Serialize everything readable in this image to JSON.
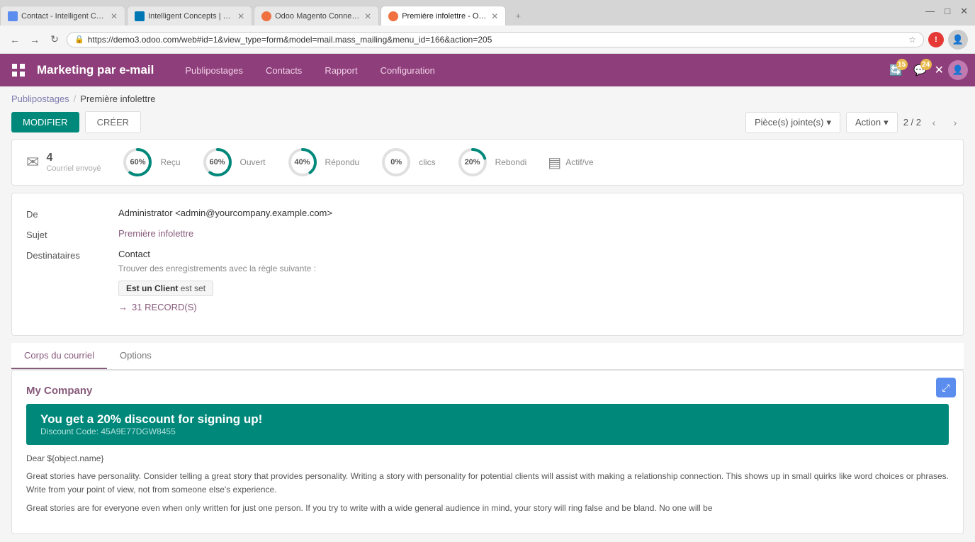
{
  "browser": {
    "tabs": [
      {
        "id": "tab1",
        "favicon_color": "#5b8def",
        "label": "Contact - Intelligent Con...",
        "active": false
      },
      {
        "id": "tab2",
        "favicon_color": "#0077b5",
        "label": "Intelligent Concepts | Lin...",
        "active": false
      },
      {
        "id": "tab3",
        "favicon_color": "#f07040",
        "label": "Odoo Magento Connect...",
        "active": false
      },
      {
        "id": "tab4",
        "favicon_color": "#f07040",
        "label": "Première infolettre - Odo...",
        "active": true
      }
    ],
    "url": "https://demo3.odoo.com/web#id=1&view_type=form&model=mail.mass_mailing&menu_id=166&action=205",
    "window_btns": [
      "—",
      "□",
      "✕"
    ]
  },
  "app": {
    "title": "Marketing par e-mail",
    "nav": [
      "Publipostages",
      "Contacts",
      "Rapport",
      "Configuration"
    ],
    "header_badges": [
      {
        "icon": "🔄",
        "count": "15"
      },
      {
        "icon": "💬",
        "count": "24"
      }
    ]
  },
  "breadcrumb": {
    "parent": "Publipostages",
    "separator": "/",
    "current": "Première infolettre"
  },
  "toolbar": {
    "modifier_label": "MODIFIER",
    "creer_label": "CRÉER",
    "pieces_jointes_label": "Pièce(s) jointe(s)",
    "action_label": "Action",
    "pagination_current": "2",
    "pagination_total": "2"
  },
  "stats": [
    {
      "type": "mail",
      "count": "4",
      "label": "Courriel envoyé"
    },
    {
      "type": "circle",
      "percent": 60,
      "label": "Reçu",
      "color": "#00897b"
    },
    {
      "type": "circle",
      "percent": 60,
      "label": "Ouvert",
      "color": "#00897b"
    },
    {
      "type": "circle",
      "percent": 40,
      "label": "Répondu",
      "color": "#00897b"
    },
    {
      "type": "circle",
      "percent": 0,
      "label": "clics",
      "color": "#00897b"
    },
    {
      "type": "circle",
      "percent": 20,
      "label": "Rebondi",
      "color": "#00897b"
    },
    {
      "type": "archive",
      "label": "Actif/ve"
    }
  ],
  "form": {
    "de_label": "De",
    "de_value": "Administrator <admin@yourcompany.example.com>",
    "sujet_label": "Sujet",
    "sujet_value": "Première infolettre",
    "destinataires_label": "Destinataires",
    "destinataires_value": "Contact",
    "trouver_text": "Trouver des enregistrements avec la règle suivante :",
    "filter_field": "Est un Client",
    "filter_op": "est set",
    "records_count": "31 RECORD(S)"
  },
  "tabs": [
    {
      "label": "Corps du courriel",
      "active": true
    },
    {
      "label": "Options",
      "active": false
    }
  ],
  "email_body": {
    "company": "My Company",
    "banner_title": "You get a 20% discount for signing up!",
    "banner_code": "Discount Code: 45A9E77DGW8455",
    "dear": "Dear ${object.name}",
    "paragraph1": "Great stories have personality. Consider telling a great story that provides personality. Writing a story with personality for potential clients will assist with making a relationship connection. This shows up in small quirks like word choices or phrases. Write from your point of view, not from someone else's experience.",
    "paragraph2": "Great stories are for everyone even when only written for just one person. If you try to write with a wide general audience in mind, your story will ring false and be bland. No one will be"
  },
  "icons": {
    "grid": "⊞",
    "chevron_down": "▾",
    "chevron_left": "‹",
    "chevron_right": "›",
    "mail": "✉",
    "archive": "▤",
    "arrow_right": "→",
    "expand": "⤢",
    "lock": "🔒"
  },
  "colors": {
    "purple": "#8e3e7a",
    "teal": "#00897b",
    "link_purple": "#875a7b",
    "badge_yellow": "#e8b84b",
    "blue_expand": "#5b8def"
  }
}
